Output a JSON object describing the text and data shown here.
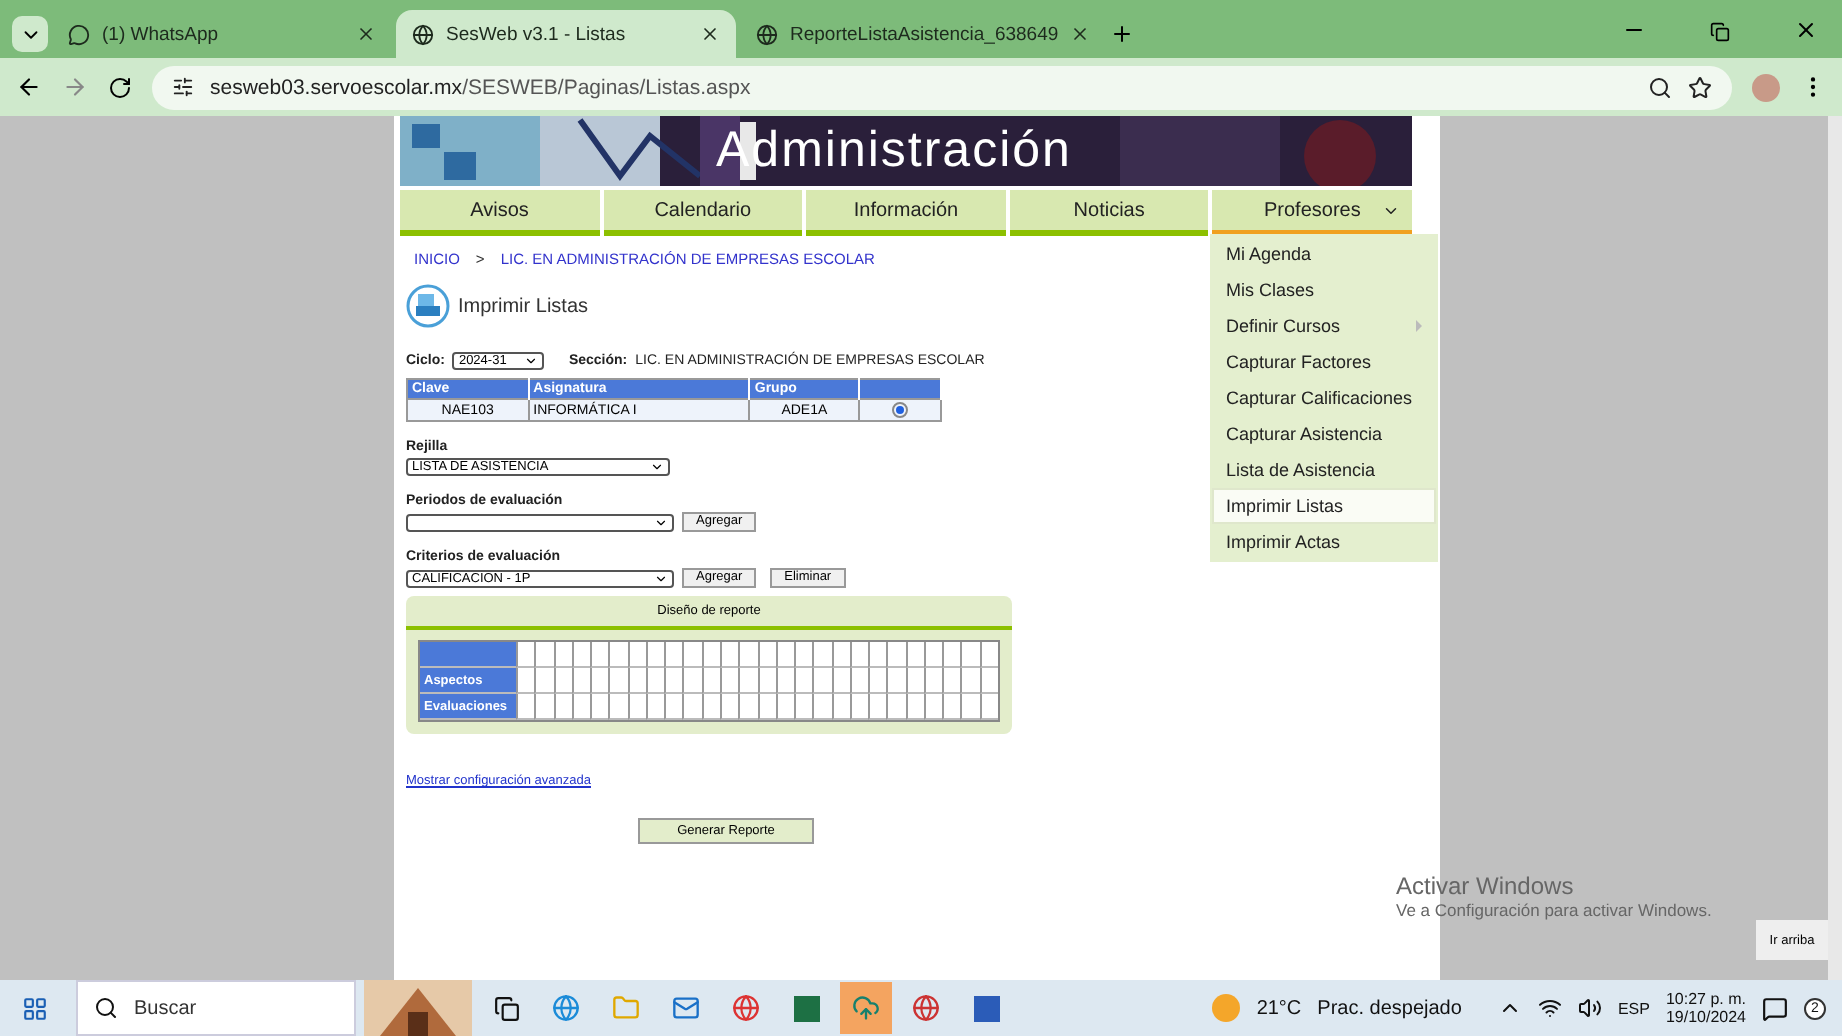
{
  "browser": {
    "tabs": [
      {
        "title": "(1) WhatsApp",
        "kind": "chat",
        "selected": false
      },
      {
        "title": "SesWeb v3.1 - Listas",
        "kind": "globe",
        "selected": true
      },
      {
        "title": "ReporteListaAsistencia_638649",
        "kind": "world",
        "selected": false
      }
    ],
    "url_host": "sesweb03.servoescolar.mx",
    "url_path": "/SESWEB/Paginas/Listas.aspx"
  },
  "banner": {
    "title": "Administración"
  },
  "nav": {
    "items": [
      {
        "label": "Avisos",
        "selected": false
      },
      {
        "label": "Calendario",
        "selected": false
      },
      {
        "label": "Información",
        "selected": false
      },
      {
        "label": "Noticias",
        "selected": false
      },
      {
        "label": "Profesores",
        "selected": true,
        "expanded": true
      }
    ],
    "menu": [
      {
        "label": "Mi Agenda",
        "selected": false,
        "has_submenu": false
      },
      {
        "label": "Mis Clases",
        "selected": false,
        "has_submenu": false
      },
      {
        "label": "Definir Cursos",
        "selected": false,
        "has_submenu": true
      },
      {
        "label": "Capturar Factores",
        "selected": false,
        "has_submenu": false
      },
      {
        "label": "Capturar Calificaciones",
        "selected": false,
        "has_submenu": false
      },
      {
        "label": "Capturar Asistencia",
        "selected": false,
        "has_submenu": false
      },
      {
        "label": "Lista de Asistencia",
        "selected": false,
        "has_submenu": false
      },
      {
        "label": "Imprimir Listas",
        "selected": true,
        "has_submenu": false
      },
      {
        "label": "Imprimir Actas",
        "selected": false,
        "has_submenu": false
      }
    ]
  },
  "breadcrumb": {
    "items": [
      "INICIO",
      "LIC. EN ADMINISTRACIÓN DE EMPRESAS ESCOLAR"
    ],
    "separator": ">"
  },
  "page_title": "Imprimir Listas",
  "ciclo": {
    "label": "Ciclo:",
    "value": "2024-31"
  },
  "seccion": {
    "label": "Sección:",
    "value": "LIC. EN ADMINISTRACIÓN DE EMPRESAS ESCOLAR"
  },
  "table": {
    "columns": [
      "Clave",
      "Asignatura",
      "Grupo"
    ],
    "rows": [
      {
        "cells": [
          "NAE103",
          "INFORMÁTICA I",
          "ADE1A"
        ],
        "selected": true
      }
    ]
  },
  "rejilla": {
    "label": "Rejilla",
    "value": "LISTA DE ASISTENCIA"
  },
  "periodos": {
    "label": "Periodos de evaluación",
    "buttons": [
      "Agregar"
    ]
  },
  "criterios": {
    "label": "Criterios de evaluación",
    "value": "CALIFICACION - 1P",
    "buttons": [
      "Agregar",
      "Eliminar"
    ]
  },
  "report_design": {
    "title": "Diseño de reporte",
    "row_labels": [
      "Aspectos",
      "Evaluaciones"
    ]
  },
  "advanced_link": "Mostrar configuración avanzada",
  "generate_button": "Generar Reporte",
  "activation": {
    "title": "Activar Windows",
    "subtitle": "Ve a Configuración para activar Windows."
  },
  "scroll_top_button": "Ir arriba",
  "taskbar": {
    "search_placeholder": "Buscar",
    "temperature": "21°C",
    "weather": "Prac. despejado",
    "language": "ESP",
    "time": "10:27 p. m.",
    "date": "19/10/2024",
    "notifications": "2"
  }
}
